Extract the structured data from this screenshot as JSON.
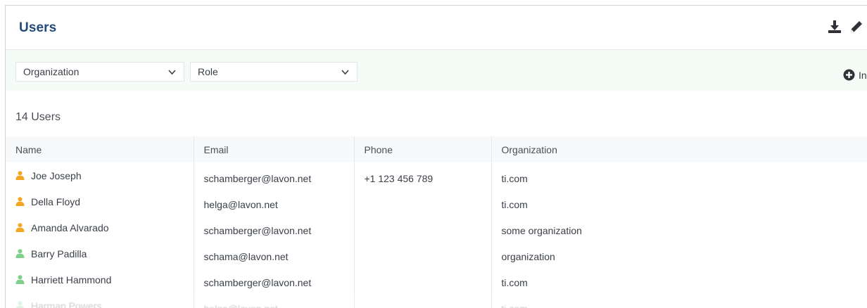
{
  "header": {
    "title": "Users",
    "icons": [
      "download-icon",
      "pencil-icon"
    ]
  },
  "filters": {
    "organization": {
      "selected": "Organization"
    },
    "role": {
      "selected": "Role"
    },
    "invite_label": "In"
  },
  "summary": {
    "count_label": "14 Users"
  },
  "table": {
    "columns": [
      "Name",
      "Email",
      "Phone",
      "Organization"
    ],
    "rows": [
      {
        "name": "Joe Joseph",
        "email": "schamberger@lavon.net",
        "phone": "+1 123 456 789",
        "organization": "ti.com",
        "icon_color": "#f5a623"
      },
      {
        "name": "Della Floyd",
        "email": "helga@lavon.net",
        "phone": "",
        "organization": "ti.com",
        "icon_color": "#f5a623"
      },
      {
        "name": "Amanda Alvarado",
        "email": "schamberger@lavon.net",
        "phone": "",
        "organization": "some organization",
        "icon_color": "#f5a623"
      },
      {
        "name": "Barry Padilla",
        "email": "schama@lavon.net",
        "phone": "",
        "organization": "organization",
        "icon_color": "#7ed08b"
      },
      {
        "name": "Harriett Hammond",
        "email": "schamberger@lavon.net",
        "phone": "",
        "organization": "ti.com",
        "icon_color": "#7ed08b"
      },
      {
        "name": "Harman Powers",
        "email": "helga@lavon.net",
        "phone": "",
        "organization": "ti.com",
        "icon_color": "#7ed08b"
      }
    ]
  },
  "colors": {
    "title": "#234a7a",
    "filter_bg": "#f5fbf6",
    "admin_user": "#f5a623",
    "regular_user": "#7ed08b"
  }
}
